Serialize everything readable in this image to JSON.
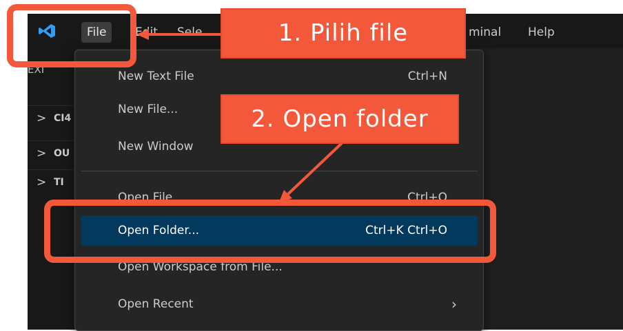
{
  "menubar": {
    "file": "File",
    "edit": "Edit",
    "selection": "Sele",
    "terminal": "minal",
    "help": "Help"
  },
  "sidebar": {
    "title": "EXI",
    "sections": [
      {
        "label": "CI4"
      },
      {
        "label": "OU"
      },
      {
        "label": "TI"
      }
    ]
  },
  "dropdown": {
    "items": [
      {
        "label": "New Text File",
        "shortcut": "Ctrl+N"
      },
      {
        "label": "New File...",
        "shortcut": ""
      },
      {
        "label": "New Window",
        "shortcut": ""
      },
      {
        "label": "Open File",
        "shortcut": "Ctrl+O"
      },
      {
        "label": "Open Folder...",
        "shortcut": "Ctrl+K Ctrl+O",
        "highlighted": true
      },
      {
        "label": "Open Workspace from File...",
        "shortcut": ""
      },
      {
        "label": "Open Recent",
        "shortcut": "",
        "submenu": true
      }
    ]
  },
  "annotations": {
    "step1": "1. Pilih file",
    "step2": "2. Open folder",
    "accent_color": "#f4583a"
  },
  "icons": {
    "app": "vscode-logo-icon",
    "chevron": "chevron-right-icon",
    "submenu": "chevron-right-icon"
  }
}
